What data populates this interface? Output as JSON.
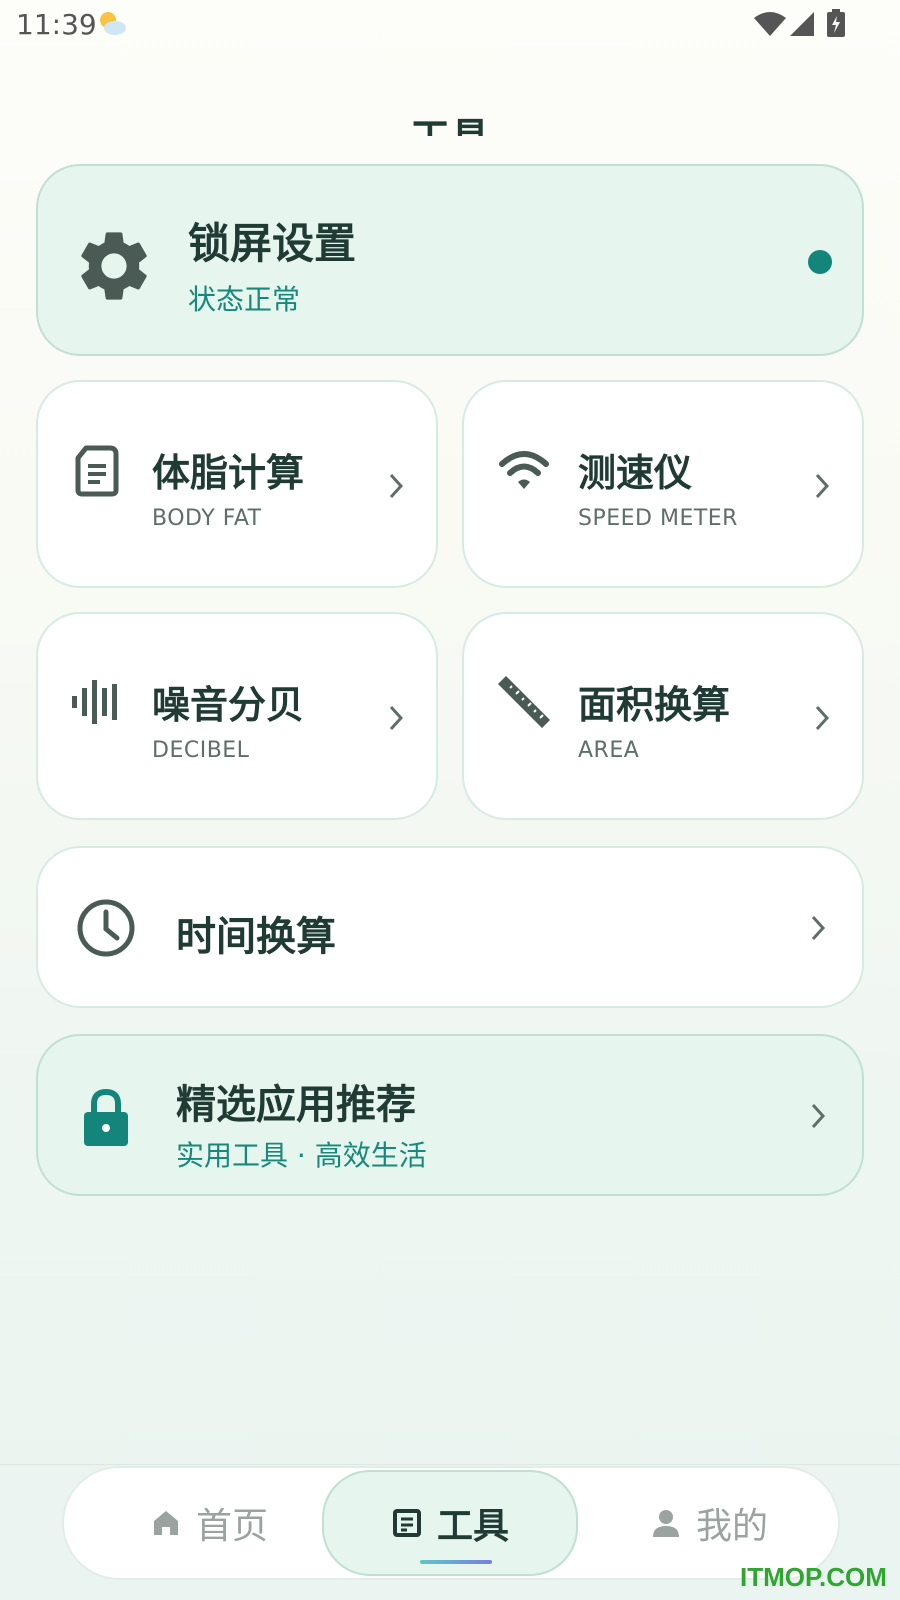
{
  "status_bar": {
    "time": "11:39",
    "weather_icon": "partly-cloudy-icon",
    "wifi_icon": "wifi-icon",
    "signal_icon": "signal-icon",
    "battery_icon": "battery-charging-icon"
  },
  "page": {
    "title": "工具"
  },
  "lock_card": {
    "title": "锁屏设置",
    "status": "状态正常",
    "icon": "gear-icon",
    "status_color": "#14857a"
  },
  "tools": [
    {
      "name": "体脂计算",
      "en": "BODY FAT",
      "icon": "document-icon"
    },
    {
      "name": "测速仪",
      "en": "SPEED METER",
      "icon": "wifi-icon"
    },
    {
      "name": "噪音分贝",
      "en": "DECIBEL",
      "icon": "sound-bars-icon"
    },
    {
      "name": "面积换算",
      "en": "AREA",
      "icon": "ruler-icon"
    }
  ],
  "time_card": {
    "name": "时间换算",
    "icon": "clock-icon"
  },
  "recommend_card": {
    "name": "精选应用推荐",
    "sub": "实用工具 · 高效生活",
    "icon": "lock-icon"
  },
  "bottom_nav": [
    {
      "label": "首页",
      "icon": "home-icon",
      "active": false
    },
    {
      "label": "工具",
      "icon": "tools-icon",
      "active": true
    },
    {
      "label": "我的",
      "icon": "person-icon",
      "active": false
    }
  ],
  "watermark": "ITMOP.COM",
  "colors": {
    "accent": "#14857a",
    "text_dark": "#1f3b34",
    "card_tint": "#e6f5ee",
    "nav_inactive": "#9aa39f"
  }
}
